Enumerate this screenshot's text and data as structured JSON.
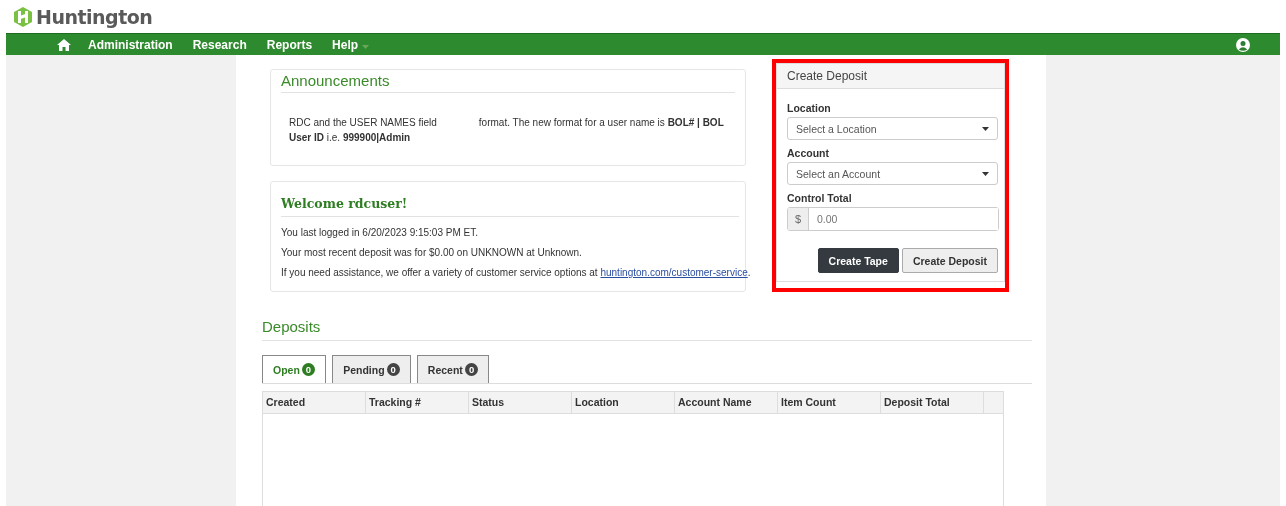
{
  "brand": {
    "name": "Huntington"
  },
  "nav": {
    "items": [
      {
        "label": "Administration",
        "has_menu": false
      },
      {
        "label": "Research",
        "has_menu": false
      },
      {
        "label": "Reports",
        "has_menu": false
      },
      {
        "label": "Help",
        "has_menu": true
      }
    ]
  },
  "announcements": {
    "title": "Announcements",
    "text_before_gap": "RDC and the USER NAMES field",
    "text_after_gap": "format. The new format for a user name is **BOL# | BOL User ID** i.e. **999900|Admin**"
  },
  "welcome": {
    "title": "Welcome rdcuser!",
    "lines": [
      {
        "text": "You last logged in 6/20/2023 9:15:03 PM ET."
      },
      {
        "text": "Your most recent deposit was for $0.00 on UNKNOWN at Unknown."
      },
      {
        "text": "If you need assistance, we offer a variety of customer service options at",
        "link": "huntington.com/customer-service",
        "after": "."
      }
    ]
  },
  "create_deposit": {
    "title": "Create Deposit",
    "highlighted": true,
    "fields": [
      {
        "kind": "select",
        "label": "Location",
        "placeholder": "Select a Location"
      },
      {
        "kind": "select",
        "label": "Account",
        "placeholder": "Select an Account"
      },
      {
        "kind": "money",
        "label": "Control Total",
        "prefix": "$",
        "placeholder": "0.00"
      }
    ],
    "buttons": [
      {
        "label": "Create Tape",
        "primary": true
      },
      {
        "label": "Create Deposit",
        "primary": false
      }
    ]
  },
  "deposits": {
    "title": "Deposits",
    "tabs": [
      {
        "label": "Open",
        "count": "0",
        "selected": true
      },
      {
        "label": "Pending",
        "count": "0",
        "selected": false
      },
      {
        "label": "Recent",
        "count": "0",
        "selected": false
      }
    ],
    "table": {
      "columns": [
        "Created",
        "Tracking #",
        "Status",
        "Location",
        "Account Name",
        "Item Count",
        "Deposit Total"
      ]
    }
  }
}
